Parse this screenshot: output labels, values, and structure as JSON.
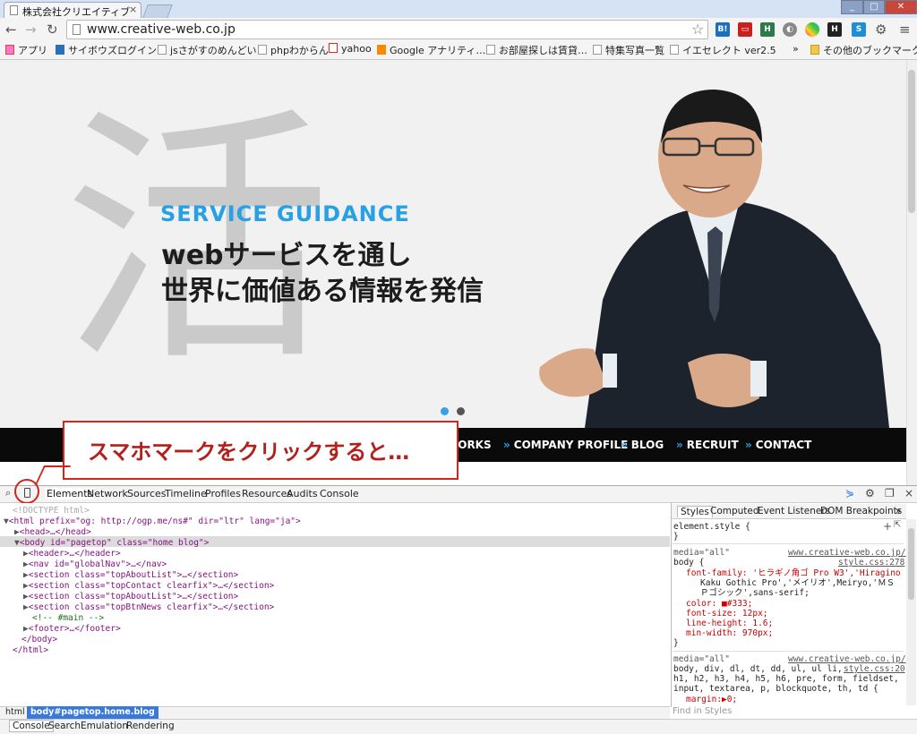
{
  "browser": {
    "tab_title": "株式会社クリエイティブ",
    "tab_close": "×",
    "url": "www.creative-web.co.jp",
    "star": "☆",
    "menu_icon": "≡",
    "settings_icon": "⚙"
  },
  "bookmarks": [
    "アプリ",
    "サイボウズログイン",
    "jsさがすのめんどい",
    "phpわからん",
    "yahoo",
    "Google アナリティ…",
    "お部屋探しは賃貸…",
    "特集写真一覧",
    "イエセレクト ver2.5",
    "»",
    "その他のブックマーク"
  ],
  "hero": {
    "calligraphy": "活",
    "service_label": "SERVICE GUIDANCE",
    "headline_1": "webサービスを通し",
    "headline_2": "世界に価値ある情報を発信"
  },
  "global_nav": [
    "WORKS",
    "COMPANY PROFILE",
    "BLOG",
    "RECRUIT",
    "CONTACT"
  ],
  "nav_arrow": "»",
  "callout": "スマホマークをクリックすると…",
  "devtools": {
    "tabs": [
      "Elements",
      "Network",
      "Sources",
      "Timeline",
      "Profiles",
      "Resources",
      "Audits",
      "Console"
    ],
    "dom_lines": [
      "<!DOCTYPE html>",
      "<html prefix=\"og: http://ogp.me/ns#\" dir=\"ltr\" lang=\"ja\">",
      "<head>…</head>",
      "<body id=\"pagetop\" class=\"home blog\">",
      "<header>…</header>",
      "<nav id=\"globalNav\">…</nav>",
      "<section class=\"topAboutList\">…</section>",
      "<section class=\"topContact clearfix\">…</section>",
      "<section class=\"topAboutList\">…</section>",
      "<section class=\"topBtnNews clearfix\">…</section>",
      "<!-- #main -->",
      "<footer>…</footer>",
      "</body>",
      "</html>"
    ],
    "styles_tabs": [
      "Styles",
      "Computed",
      "Event Listeners",
      "DOM Breakpoints",
      "»"
    ],
    "styles": {
      "element_style": "element.style {",
      "close_brace": "}",
      "media": "media=\"all\"",
      "source_domain": "www.creative-web.co.jp/",
      "source_1": "style.css:278",
      "selector_1": "body {",
      "font_family": "font-family: 'ヒラギノ角ゴ Pro W3','Hiragino",
      "font_family_2": "Kaku Gothic Pro','メイリオ',Meiryo,'ＭＳ",
      "font_family_3": "Ｐゴシック',sans-serif;",
      "color": "color: ■#333;",
      "font_size": "font-size: 12px;",
      "line_height": "line-height: 1.6;",
      "min_width": "min-width: 970px;",
      "selector_2a": "body, div, dl, dt, dd, ul, ul li,",
      "source_2": "style.css:20",
      "selector_2b": "h1, h2, h3, h4, h5, h6, pre, form, fieldset,",
      "selector_2c": "input, textarea, p, blockquote, th, td {",
      "margin": "margin:▶0;"
    },
    "find_in_styles": "Find in Styles",
    "breadcrumb": [
      "html",
      "body#pagetop.home.blog"
    ],
    "drawer_tabs": [
      "Console",
      "Search",
      "Emulation",
      "Rendering"
    ]
  },
  "colors": {
    "accent_blue": "#27a0e5",
    "callout_red": "#d0271c",
    "nav_bg": "#0a0a0a"
  }
}
